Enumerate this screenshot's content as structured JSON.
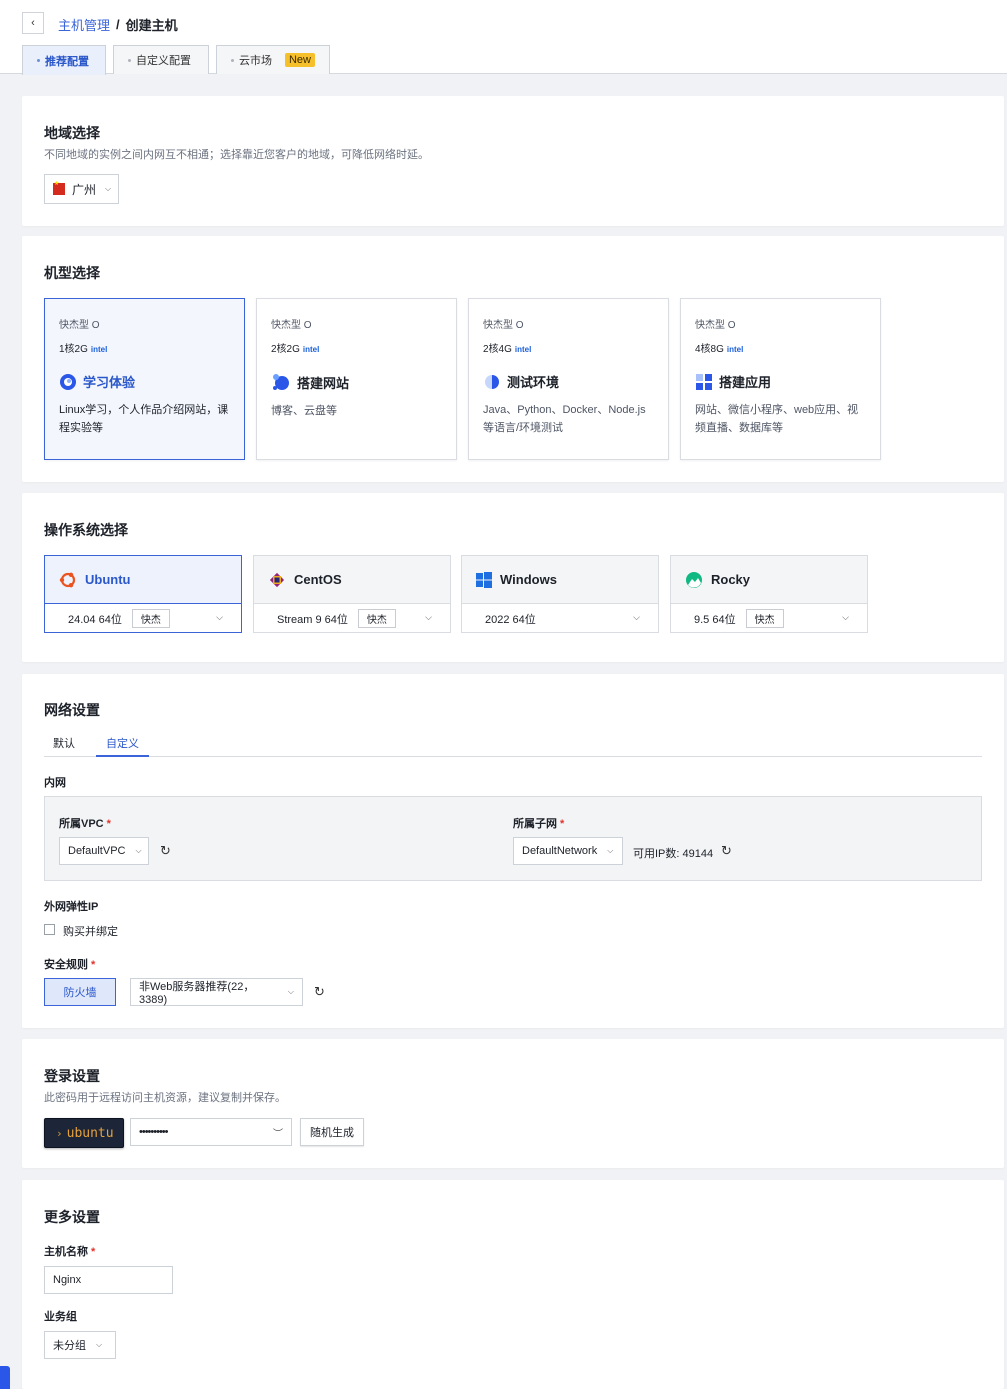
{
  "breadcrumb": {
    "parent": "主机管理",
    "separator": "/",
    "current": "创建主机"
  },
  "tabs": [
    {
      "label": "推荐配置"
    },
    {
      "label": "自定义配置"
    },
    {
      "label": "云市场",
      "badge": "New"
    }
  ],
  "region": {
    "title": "地域选择",
    "subtitle": "不同地域的实例之间内网互不相通；选择靠近您客户的地域，可降低网络时延。",
    "selected": "广州"
  },
  "specs": {
    "title": "机型选择",
    "brand": "intel",
    "items": [
      {
        "type": "快杰型 O",
        "config": "1核2G",
        "name": "学习体验",
        "desc": "Linux学习，个人作品介绍网站，课程实验等"
      },
      {
        "type": "快杰型 O",
        "config": "2核2G",
        "name": "搭建网站",
        "desc": "博客、云盘等"
      },
      {
        "type": "快杰型 O",
        "config": "2核4G",
        "name": "测试环境",
        "desc": "Java、Python、Docker、Node.js等语言/环境测试"
      },
      {
        "type": "快杰型 O",
        "config": "4核8G",
        "name": "搭建应用",
        "desc": "网站、微信小程序、web应用、视频直播、数据库等"
      }
    ]
  },
  "os": {
    "title": "操作系统选择",
    "items": [
      {
        "name": "Ubuntu",
        "version": "24.04 64位",
        "tag": "快杰",
        "icon": "ubuntu-icon",
        "color": "#e95420"
      },
      {
        "name": "CentOS",
        "version": "Stream 9 64位",
        "tag": "快杰",
        "icon": "centos-icon",
        "color": "#932279"
      },
      {
        "name": "Windows",
        "version": "2022 64位",
        "tag": "",
        "icon": "windows-icon",
        "color": "#1e6fe0"
      },
      {
        "name": "Rocky",
        "version": "9.5 64位",
        "tag": "快杰",
        "icon": "rocky-icon",
        "color": "#10b981"
      }
    ]
  },
  "network": {
    "title": "网络设置",
    "tabs": [
      "默认",
      "自定义"
    ],
    "intranet_label": "内网",
    "vpc_label": "所属VPC",
    "vpc_value": "DefaultVPC",
    "subnet_label": "所属子网",
    "subnet_value": "DefaultNetwork",
    "available_ip": "可用IP数: 49144",
    "eip_label": "外网弹性IP",
    "eip_checkbox": "购买并绑定",
    "security_label": "安全规则",
    "firewall_btn": "防火墙",
    "firewall_value": "非Web服务器推荐(22，3389)"
  },
  "login": {
    "title": "登录设置",
    "subtitle": "此密码用于远程访问主机资源，建议复制并保存。",
    "user": "ubuntu",
    "password_mask": "••••••••••",
    "random_btn": "随机生成"
  },
  "more": {
    "title": "更多设置",
    "hostname_label": "主机名称",
    "hostname_value": "Nginx",
    "group_label": "业务组",
    "group_value": "未分组"
  },
  "colors": {
    "accent": "#3a64d8",
    "badge": "#f6c02c",
    "required": "#e0322b"
  }
}
